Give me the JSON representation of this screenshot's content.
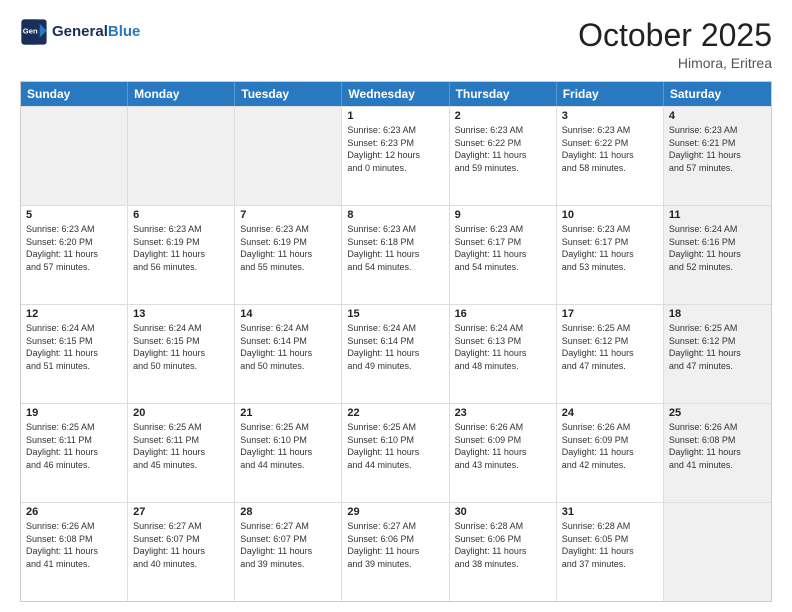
{
  "header": {
    "logo_line1": "General",
    "logo_line2": "Blue",
    "month": "October 2025",
    "location": "Himora, Eritrea"
  },
  "weekdays": [
    "Sunday",
    "Monday",
    "Tuesday",
    "Wednesday",
    "Thursday",
    "Friday",
    "Saturday"
  ],
  "rows": [
    [
      {
        "day": "",
        "text": "",
        "shaded": true
      },
      {
        "day": "",
        "text": "",
        "shaded": true
      },
      {
        "day": "",
        "text": "",
        "shaded": true
      },
      {
        "day": "1",
        "text": "Sunrise: 6:23 AM\nSunset: 6:23 PM\nDaylight: 12 hours\nand 0 minutes.",
        "shaded": false
      },
      {
        "day": "2",
        "text": "Sunrise: 6:23 AM\nSunset: 6:22 PM\nDaylight: 11 hours\nand 59 minutes.",
        "shaded": false
      },
      {
        "day": "3",
        "text": "Sunrise: 6:23 AM\nSunset: 6:22 PM\nDaylight: 11 hours\nand 58 minutes.",
        "shaded": false
      },
      {
        "day": "4",
        "text": "Sunrise: 6:23 AM\nSunset: 6:21 PM\nDaylight: 11 hours\nand 57 minutes.",
        "shaded": true
      }
    ],
    [
      {
        "day": "5",
        "text": "Sunrise: 6:23 AM\nSunset: 6:20 PM\nDaylight: 11 hours\nand 57 minutes.",
        "shaded": false
      },
      {
        "day": "6",
        "text": "Sunrise: 6:23 AM\nSunset: 6:19 PM\nDaylight: 11 hours\nand 56 minutes.",
        "shaded": false
      },
      {
        "day": "7",
        "text": "Sunrise: 6:23 AM\nSunset: 6:19 PM\nDaylight: 11 hours\nand 55 minutes.",
        "shaded": false
      },
      {
        "day": "8",
        "text": "Sunrise: 6:23 AM\nSunset: 6:18 PM\nDaylight: 11 hours\nand 54 minutes.",
        "shaded": false
      },
      {
        "day": "9",
        "text": "Sunrise: 6:23 AM\nSunset: 6:17 PM\nDaylight: 11 hours\nand 54 minutes.",
        "shaded": false
      },
      {
        "day": "10",
        "text": "Sunrise: 6:23 AM\nSunset: 6:17 PM\nDaylight: 11 hours\nand 53 minutes.",
        "shaded": false
      },
      {
        "day": "11",
        "text": "Sunrise: 6:24 AM\nSunset: 6:16 PM\nDaylight: 11 hours\nand 52 minutes.",
        "shaded": true
      }
    ],
    [
      {
        "day": "12",
        "text": "Sunrise: 6:24 AM\nSunset: 6:15 PM\nDaylight: 11 hours\nand 51 minutes.",
        "shaded": false
      },
      {
        "day": "13",
        "text": "Sunrise: 6:24 AM\nSunset: 6:15 PM\nDaylight: 11 hours\nand 50 minutes.",
        "shaded": false
      },
      {
        "day": "14",
        "text": "Sunrise: 6:24 AM\nSunset: 6:14 PM\nDaylight: 11 hours\nand 50 minutes.",
        "shaded": false
      },
      {
        "day": "15",
        "text": "Sunrise: 6:24 AM\nSunset: 6:14 PM\nDaylight: 11 hours\nand 49 minutes.",
        "shaded": false
      },
      {
        "day": "16",
        "text": "Sunrise: 6:24 AM\nSunset: 6:13 PM\nDaylight: 11 hours\nand 48 minutes.",
        "shaded": false
      },
      {
        "day": "17",
        "text": "Sunrise: 6:25 AM\nSunset: 6:12 PM\nDaylight: 11 hours\nand 47 minutes.",
        "shaded": false
      },
      {
        "day": "18",
        "text": "Sunrise: 6:25 AM\nSunset: 6:12 PM\nDaylight: 11 hours\nand 47 minutes.",
        "shaded": true
      }
    ],
    [
      {
        "day": "19",
        "text": "Sunrise: 6:25 AM\nSunset: 6:11 PM\nDaylight: 11 hours\nand 46 minutes.",
        "shaded": false
      },
      {
        "day": "20",
        "text": "Sunrise: 6:25 AM\nSunset: 6:11 PM\nDaylight: 11 hours\nand 45 minutes.",
        "shaded": false
      },
      {
        "day": "21",
        "text": "Sunrise: 6:25 AM\nSunset: 6:10 PM\nDaylight: 11 hours\nand 44 minutes.",
        "shaded": false
      },
      {
        "day": "22",
        "text": "Sunrise: 6:25 AM\nSunset: 6:10 PM\nDaylight: 11 hours\nand 44 minutes.",
        "shaded": false
      },
      {
        "day": "23",
        "text": "Sunrise: 6:26 AM\nSunset: 6:09 PM\nDaylight: 11 hours\nand 43 minutes.",
        "shaded": false
      },
      {
        "day": "24",
        "text": "Sunrise: 6:26 AM\nSunset: 6:09 PM\nDaylight: 11 hours\nand 42 minutes.",
        "shaded": false
      },
      {
        "day": "25",
        "text": "Sunrise: 6:26 AM\nSunset: 6:08 PM\nDaylight: 11 hours\nand 41 minutes.",
        "shaded": true
      }
    ],
    [
      {
        "day": "26",
        "text": "Sunrise: 6:26 AM\nSunset: 6:08 PM\nDaylight: 11 hours\nand 41 minutes.",
        "shaded": false
      },
      {
        "day": "27",
        "text": "Sunrise: 6:27 AM\nSunset: 6:07 PM\nDaylight: 11 hours\nand 40 minutes.",
        "shaded": false
      },
      {
        "day": "28",
        "text": "Sunrise: 6:27 AM\nSunset: 6:07 PM\nDaylight: 11 hours\nand 39 minutes.",
        "shaded": false
      },
      {
        "day": "29",
        "text": "Sunrise: 6:27 AM\nSunset: 6:06 PM\nDaylight: 11 hours\nand 39 minutes.",
        "shaded": false
      },
      {
        "day": "30",
        "text": "Sunrise: 6:28 AM\nSunset: 6:06 PM\nDaylight: 11 hours\nand 38 minutes.",
        "shaded": false
      },
      {
        "day": "31",
        "text": "Sunrise: 6:28 AM\nSunset: 6:05 PM\nDaylight: 11 hours\nand 37 minutes.",
        "shaded": false
      },
      {
        "day": "",
        "text": "",
        "shaded": true
      }
    ]
  ]
}
